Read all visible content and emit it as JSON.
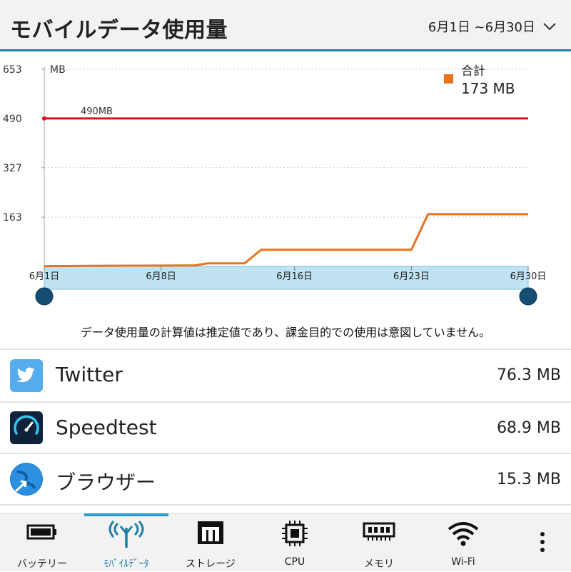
{
  "header": {
    "title": "モバイルデータ使用量",
    "date_range": "6月1日 ~6月30日"
  },
  "chart_data": {
    "type": "line",
    "ylabel_unit": "MB",
    "yticks": [
      653,
      490,
      327,
      163
    ],
    "ylim": [
      0,
      653
    ],
    "x_ticks": [
      "6月1日",
      "6月8日",
      "6月16日",
      "6月23日",
      "6月30日"
    ],
    "x_tick_days": [
      1,
      8,
      16,
      23,
      30
    ],
    "limit_line": {
      "value": 490,
      "label": "490MB",
      "color": "#d9161c"
    },
    "legend": {
      "name": "合計",
      "total": "173 MB",
      "color": "#e8731e",
      "placement": "top-right"
    },
    "series": [
      {
        "name": "合計",
        "color": "#e8731e",
        "x": [
          1,
          5,
          10,
          10.8,
          13,
          14,
          17,
          23,
          24,
          30
        ],
        "y": [
          1,
          2,
          3,
          10,
          10,
          55,
          55,
          55,
          173,
          173
        ]
      }
    ],
    "grid": true
  },
  "notice": "データ使用量の計算値は推定値であり、課金目的での使用は意図していません。",
  "apps": [
    {
      "name": "Twitter",
      "value": "76.3 MB",
      "icon": "twitter-icon"
    },
    {
      "name": "Speedtest",
      "value": "68.9 MB",
      "icon": "speedtest-icon"
    },
    {
      "name": "ブラウザー",
      "value": "15.3 MB",
      "icon": "browser-icon"
    }
  ],
  "tabs": [
    {
      "label": "バッテリー",
      "icon": "battery-icon"
    },
    {
      "label": "ﾓﾊﾞｲﾙﾃﾞｰﾀ",
      "icon": "antenna-icon",
      "active": true
    },
    {
      "label": "ストレージ",
      "icon": "storage-icon"
    },
    {
      "label": "CPU",
      "icon": "cpu-icon"
    },
    {
      "label": "メモリ",
      "icon": "memory-icon"
    },
    {
      "label": "Wi-Fi",
      "icon": "wifi-icon"
    }
  ],
  "colors": {
    "accent": "#1f7fa8",
    "range_fill": "#bfe3f2",
    "handle": "#154e72"
  }
}
